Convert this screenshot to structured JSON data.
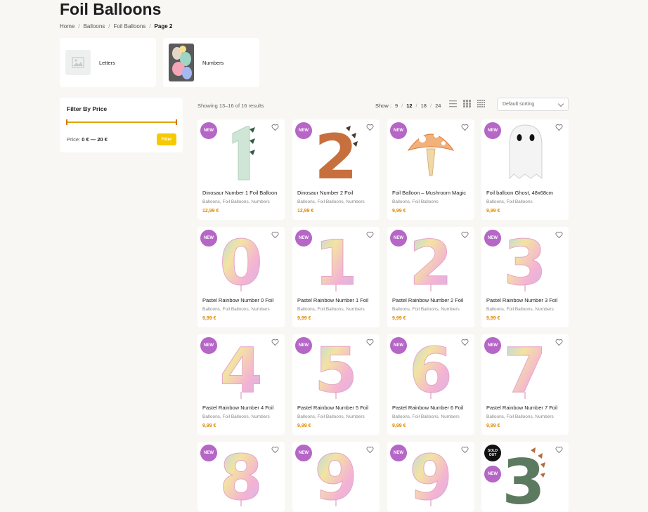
{
  "page": {
    "title": "Foil Balloons"
  },
  "breadcrumb": [
    "Home",
    "Balloons",
    "Foil Balloons",
    "Page 2"
  ],
  "categories": [
    {
      "label": "Letters",
      "icon": "image-placeholder-icon"
    },
    {
      "label": "Numbers",
      "icon": "numbers-balloon-thumbnail"
    }
  ],
  "filter": {
    "title": "Filter By Price",
    "price_label": "Price:",
    "price_range": "0 € — 20 €",
    "button": "Filter"
  },
  "toolbar": {
    "results": "Showing 13–16 of 16 results",
    "show_label": "Show :",
    "show_options": [
      "9",
      "12",
      "18",
      "24"
    ],
    "show_selected": "12",
    "sorting": "Default sorting"
  },
  "products": [
    {
      "name": "Dinosaur Number 1 Foil Balloon",
      "cats": "Balloons, Foil Balloons, Numbers",
      "price": "12,99 €",
      "badge": "NEW",
      "art": "dino1"
    },
    {
      "name": "Dinosaur Number 2 Foil",
      "cats": "Balloons, Foil Balloons, Numbers",
      "price": "12,99 €",
      "badge": "NEW",
      "art": "dino2"
    },
    {
      "name": "Foil Balloon – Mushroom Magic",
      "cats": "Balloons, Foil Balloons",
      "price": "9,99 €",
      "badge": "NEW",
      "art": "mushroom"
    },
    {
      "name": "Foil balloon Ghost, 48x68cm",
      "cats": "Balloons, Foil Balloons",
      "price": "9,99 €",
      "badge": "NEW",
      "art": "ghost"
    },
    {
      "name": "Pastel Rainbow Number 0 Foil",
      "cats": "Balloons, Foil Balloons, Numbers",
      "price": "9,99 €",
      "badge": "NEW",
      "art": "0"
    },
    {
      "name": "Pastel Rainbow Number 1 Foil",
      "cats": "Balloons, Foil Balloons, Numbers",
      "price": "9,99 €",
      "badge": "NEW",
      "art": "1"
    },
    {
      "name": "Pastel Rainbow Number 2 Foil",
      "cats": "Balloons, Foil Balloons, Numbers",
      "price": "9,99 €",
      "badge": "NEW",
      "art": "2"
    },
    {
      "name": "Pastel Rainbow Number 3 Foil",
      "cats": "Balloons, Foil Balloons, Numbers",
      "price": "9,99 €",
      "badge": "NEW",
      "art": "3"
    },
    {
      "name": "Pastel Rainbow Number 4 Foil",
      "cats": "Balloons, Foil Balloons, Numbers",
      "price": "9,99 €",
      "badge": "NEW",
      "art": "4"
    },
    {
      "name": "Pastel Rainbow Number 5 Foil",
      "cats": "Balloons, Foil Balloons, Numbers",
      "price": "9,99 €",
      "badge": "NEW",
      "art": "5"
    },
    {
      "name": "Pastel Rainbow Number 6 Foil",
      "cats": "Balloons, Foil Balloons, Numbers",
      "price": "9,99 €",
      "badge": "NEW",
      "art": "6"
    },
    {
      "name": "Pastel Rainbow Number 7 Foil",
      "cats": "Balloons, Foil Balloons, Numbers",
      "price": "9,99 €",
      "badge": "NEW",
      "art": "7"
    },
    {
      "name": "",
      "cats": "",
      "price": "",
      "badge": "NEW",
      "art": "8"
    },
    {
      "name": "",
      "cats": "",
      "price": "",
      "badge": "NEW",
      "art": "9"
    },
    {
      "name": "",
      "cats": "",
      "price": "",
      "badge": "NEW",
      "art": "9"
    },
    {
      "name": "",
      "cats": "",
      "price": "",
      "badge": "NEW",
      "sold": "SOLD OUT",
      "art": "dino3"
    }
  ],
  "colors": {
    "badge_new": "#b566c6",
    "price": "#e08a00",
    "filter_button": "#f7c900",
    "slider": "#e0a400"
  }
}
